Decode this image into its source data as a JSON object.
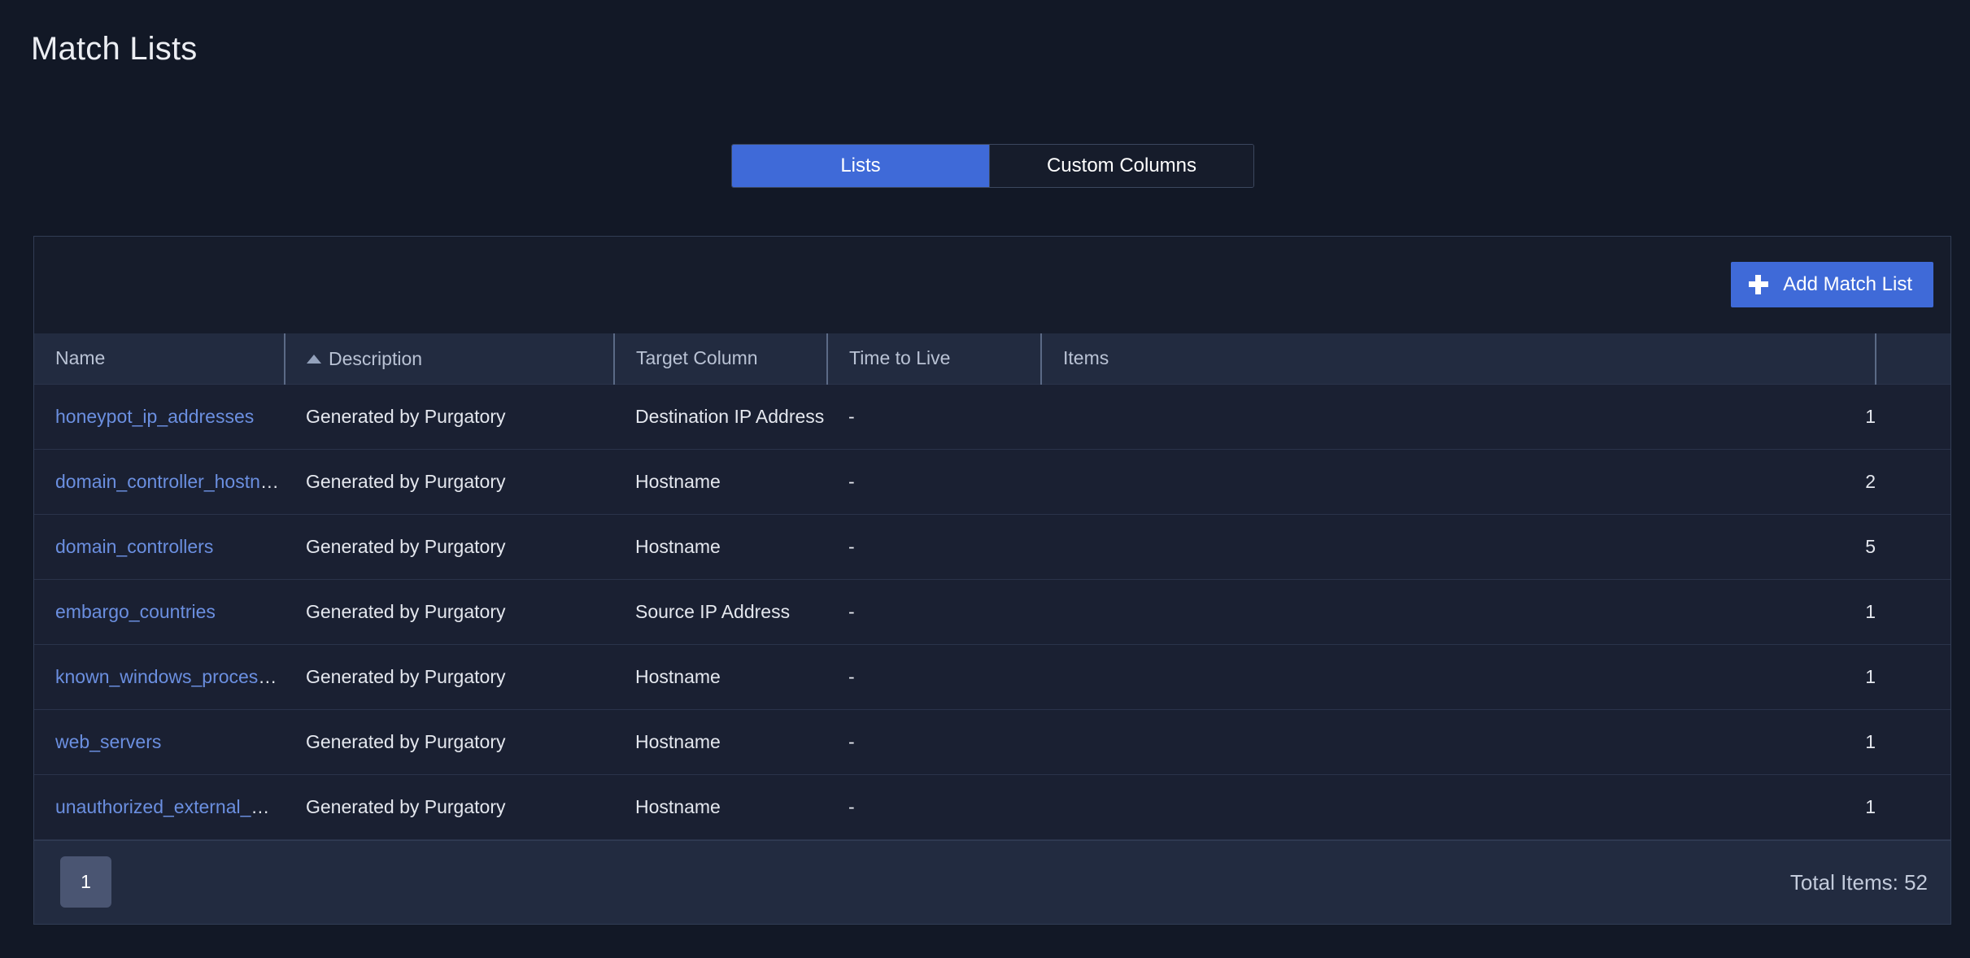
{
  "page": {
    "title": "Match Lists"
  },
  "tabs": [
    {
      "label": "Lists",
      "active": true
    },
    {
      "label": "Custom Columns",
      "active": false
    }
  ],
  "toolbar": {
    "add_button_label": "Add Match List",
    "add_button_icon": "plus-icon",
    "accent_color": "#3f6ad8"
  },
  "table": {
    "columns": [
      {
        "label": "Name",
        "key": "name"
      },
      {
        "label": "Description",
        "key": "description",
        "sorted": "asc",
        "sort_icon": "sort-ascending-icon"
      },
      {
        "label": "Target Column",
        "key": "target_column"
      },
      {
        "label": "Time to Live",
        "key": "time_to_live"
      },
      {
        "label": "Items",
        "key": "items"
      },
      {
        "label": "",
        "key": "actions"
      }
    ],
    "rows": [
      {
        "name": "honeypot_ip_addresses",
        "description": "Generated by Purgatory",
        "target_column": "Destination IP Address",
        "time_to_live": "-",
        "items": "1"
      },
      {
        "name": "domain_controller_hostnames",
        "description": "Generated by Purgatory",
        "target_column": "Hostname",
        "time_to_live": "-",
        "items": "2"
      },
      {
        "name": "domain_controllers",
        "description": "Generated by Purgatory",
        "target_column": "Hostname",
        "time_to_live": "-",
        "items": "5"
      },
      {
        "name": "embargo_countries",
        "description": "Generated by Purgatory",
        "target_column": "Source IP Address",
        "time_to_live": "-",
        "items": "1"
      },
      {
        "name": "known_windows_processes",
        "description": "Generated by Purgatory",
        "target_column": "Hostname",
        "time_to_live": "-",
        "items": "1"
      },
      {
        "name": "web_servers",
        "description": "Generated by Purgatory",
        "target_column": "Hostname",
        "time_to_live": "-",
        "items": "1"
      },
      {
        "name": "unauthorized_external_media",
        "description": "Generated by Purgatory",
        "target_column": "Hostname",
        "time_to_live": "-",
        "items": "1"
      }
    ]
  },
  "footer": {
    "pages": [
      "1"
    ],
    "current_page": "1",
    "total_items_label": "Total Items: 52"
  },
  "colors": {
    "page_background": "#121826",
    "card_background": "#161c2b",
    "header_row": "#222b40",
    "body_row": "#1a2032",
    "link": "#6b8fe0",
    "accent": "#3f6ad8"
  }
}
